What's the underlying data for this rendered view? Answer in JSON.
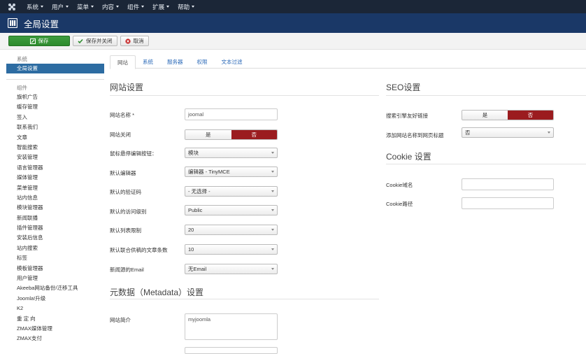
{
  "top_menu": {
    "items": [
      {
        "label": "系统",
        "icon": "chevron-down-icon"
      },
      {
        "label": "用户",
        "icon": "chevron-down-icon"
      },
      {
        "label": "菜单",
        "icon": "chevron-down-icon"
      },
      {
        "label": "内容",
        "icon": "chevron-down-icon"
      },
      {
        "label": "组件",
        "icon": "chevron-down-icon"
      },
      {
        "label": "扩展",
        "icon": "chevron-down-icon"
      },
      {
        "label": "帮助",
        "icon": "chevron-down-icon"
      }
    ]
  },
  "header": {
    "title": "全局设置",
    "icon": "settings-grid-icon"
  },
  "toolbar": {
    "save_label": "保存",
    "save_close_label": "保存并关闭",
    "cancel_label": "取消"
  },
  "sidebar": {
    "system_heading": "系统",
    "active_item": "全局设置",
    "components_heading": "组件",
    "items": [
      "旗帜广告",
      "缓存管理",
      "签入",
      "联系我们",
      "文章",
      "智能搜索",
      "安装管理",
      "语言管理器",
      "媒体管理",
      "菜单管理",
      "站内信息",
      "模块管理器",
      "新闻联播",
      "插件管理器",
      "安装后信息",
      "站内搜索",
      "标签",
      "模板管理器",
      "用户管理",
      "Akeeba网站备份/迁移工具",
      "Joomla!升级",
      "K2",
      "重 定 向",
      "ZMAX媒体管理",
      "ZMAX支付"
    ]
  },
  "tabs": [
    {
      "label": "网站",
      "active": true
    },
    {
      "label": "系统",
      "active": false
    },
    {
      "label": "服务器",
      "active": false
    },
    {
      "label": "权限",
      "active": false
    },
    {
      "label": "文本过滤",
      "active": false
    }
  ],
  "site_settings": {
    "title": "网站设置",
    "site_name_label": "网站名称 *",
    "site_name_value": "joomal",
    "site_offline_label": "网站关闭",
    "mouseover_label": "鼠标悬停编辑按钮：",
    "mouseover_value": "模块",
    "editor_label": "默认编辑器",
    "editor_value": "编辑器 - TinyMCE",
    "captcha_label": "默认的验证码",
    "captcha_value": "- 无选择 -",
    "access_label": "默认的访问级别",
    "access_value": "Public",
    "list_limit_label": "默认列表限制",
    "list_limit_value": "20",
    "feed_limit_label": "默认联合供稿的文章条数",
    "feed_limit_value": "10",
    "feed_email_label": "新闻源的Email",
    "feed_email_value": "无Email"
  },
  "toggle": {
    "yes": "是",
    "no": "否",
    "selected": "否",
    "selected_color": "#9b1c1f"
  },
  "metadata": {
    "title": "元数据（Metadata）设置",
    "desc_label": "网站简介",
    "desc_value": "myjoomla"
  },
  "seo": {
    "title": "SEO设置",
    "sef_label": "搜索引擎友好链接",
    "sitename_label": "添加网站名称到网页标题",
    "sitename_value": "否"
  },
  "cookie": {
    "title": "Cookie 设置",
    "domain_label": "Cookie域名",
    "path_label": "Cookie路径"
  }
}
